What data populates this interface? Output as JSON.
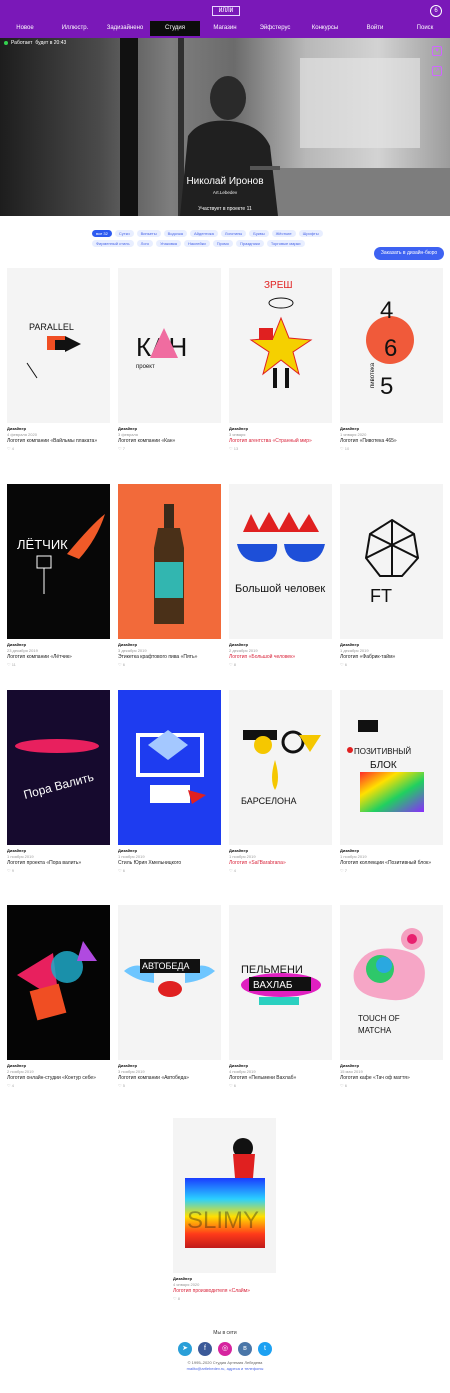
{
  "header": {
    "logo": "ИЛЛИ",
    "bell": "6",
    "nav": [
      "Новое",
      "Иллюстр.",
      "Задизайнено",
      "Студия",
      "Магазин",
      "Эйфстерус",
      "Конкурсы",
      "Войти",
      "Поиск"
    ],
    "active_index": 3
  },
  "profile": {
    "status": "Работает",
    "status_extra": "будет в 20:43",
    "name": "Николай Иронов",
    "role": "Art.Lebedev",
    "since": "Участвует в проекте 11"
  },
  "tags": [
    "все 32",
    "Сутки",
    "Виньеты",
    "Водочка",
    "Айдентика",
    "Логотипы",
    "Буквы",
    "Жёсткие",
    "Шрифты",
    "Фирменный стиль",
    "Лого",
    "Упаковка",
    "Наклейки",
    "Промо",
    "Праздники",
    "Торговые марки"
  ],
  "request_button": "Заказать в дизайн-бюро",
  "cards": [
    {
      "cat": "Дизайнер",
      "date": "4 февраля 2020",
      "title": "Логотип компании «Вайльмы плаката»",
      "likes": "4",
      "red": false
    },
    {
      "cat": "Дизайнер",
      "date": "3 февраля",
      "title": "Логотип компании «Кан»",
      "likes": "7",
      "red": false
    },
    {
      "cat": "Дизайнер",
      "date": "3 января",
      "title": "Логотип агентства «Странный мир»",
      "likes": "13",
      "red": true
    },
    {
      "cat": "Дизайнер",
      "date": "1 января 2020",
      "title": "Логотип «Пивотека 465»",
      "likes": "10",
      "red": false
    },
    {
      "cat": "Дизайнер",
      "date": "23 декабря 2019",
      "title": "Логотип компании «Лётчик»",
      "likes": "11",
      "red": false
    },
    {
      "cat": "Дизайнер",
      "date": "3 декабря 2019",
      "title": "Этикетка крафтового пива «Пять»",
      "likes": "6",
      "red": false
    },
    {
      "cat": "Дизайнер",
      "date": "2 декабря 2019",
      "title": "Логотип «Большой человек»",
      "likes": "8",
      "red": true
    },
    {
      "cat": "Дизайнер",
      "date": "1 декабря 2019",
      "title": "Логотип «Фабрик-тайм»",
      "likes": "6",
      "red": false
    },
    {
      "cat": "Дизайнер",
      "date": "1 ноября 2019",
      "title": "Логотип проекта «Пора валить»",
      "likes": "9",
      "red": false
    },
    {
      "cat": "Дизайнер",
      "date": "1 ноября 2019",
      "title": "Стиль Юрия Хмельницкого",
      "likes": "6",
      "red": false
    },
    {
      "cat": "Дизайнер",
      "date": "1 ноября 2019",
      "title": "Логотип «Sal'Barabrana»",
      "likes": "4",
      "red": true
    },
    {
      "cat": "Дизайнер",
      "date": "1 ноября 2019",
      "title": "Логотип коллекции «Позитивный блок»",
      "likes": "7",
      "red": false
    },
    {
      "cat": "Дизайнер",
      "date": "2 ноября 2019",
      "title": "Логотип онлайн-студии «Контур себе»",
      "likes": "4",
      "red": false
    },
    {
      "cat": "Дизайнер",
      "date": "3 ноября 2019",
      "title": "Логотип компании «Автобеда»",
      "likes": "5",
      "red": false
    },
    {
      "cat": "Дизайнер",
      "date": "4 ноября 2019",
      "title": "Логотип «Пельмени Вахлаб»",
      "likes": "6",
      "red": false
    },
    {
      "cat": "Дизайнер",
      "date": "15 мая 2019",
      "title": "Логотип кафе «Тач оф маття»",
      "likes": "6",
      "red": false
    },
    {
      "cat": "Дизайнер",
      "date": "4 января 2020",
      "title": "Логотип производителя «Слайм»",
      "likes": "8",
      "red": true
    }
  ],
  "art": {
    "card1": "PARALLEL",
    "card2_big": "КАН",
    "card2_small": "проект",
    "card3": "ЗРЕШ",
    "card4_digits": [
      "4",
      "6",
      "5"
    ],
    "card4_side": "пивотека",
    "card5": "ЛЁТЧИК",
    "card7": "Большой человек",
    "card8": "FT",
    "card9": "Пора Валить",
    "card11": "БАРСЕЛОНА",
    "card12_a": "ПОЗИТИВНЫЙ",
    "card12_b": "БЛОК",
    "card14": "АВТОБЕДА",
    "card15_a": "ПЕЛЬМЕНИ",
    "card15_b": "ВАХЛАБ",
    "card16_a": "TOUCH OF",
    "card16_b": "MATCHA",
    "card17": "SLIMY"
  },
  "footer": {
    "title": "Мы в сети",
    "socials": [
      "tg",
      "f",
      "ig",
      "vk",
      "tw"
    ],
    "copy": "© 1995–2020 Студия Артемия Лебедева",
    "mail": "mailto@artlebedev.ru, адреса и телефоны"
  }
}
